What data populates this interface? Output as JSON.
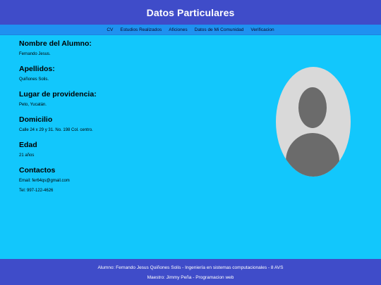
{
  "header": {
    "title": "Datos Particulares"
  },
  "nav": {
    "items": [
      "CV",
      "Estudios Realizados",
      "Aficiones",
      "Datos de Mi Comunidad",
      "Verificacion"
    ]
  },
  "profile": {
    "name_heading": "Nombre del Alumno:",
    "name_value": "Fernando Jesus.",
    "surname_heading": "Apellidos:",
    "surname_value": "Quiñones Solis.",
    "origin_heading": "Lugar de providencia:",
    "origin_value": "Peto, Yucatán.",
    "address_heading": "Domicilio",
    "address_value": "Calle 24 x 29 y 31. No. 198 Col. centro.",
    "age_heading": "Edad",
    "age_value": "21 años",
    "contacts_heading": "Contactos",
    "email": "Email: fer64qs@gmail.com",
    "phone": "Tel: 997-122-4626"
  },
  "footer": {
    "line1": "Alumno: Fernando Jesus Quiñones Solis - Ingeniería en sistemas computacionales - 8 AVS",
    "line2": "Maestro: Jimmy Peña - Programacion web"
  },
  "colors": {
    "page_background": "#12c7fc",
    "header_background": "#3f4cc9",
    "nav_background": "#1f91f0",
    "avatar_background": "#d9d9d9",
    "avatar_silhouette": "#6b6b6b"
  },
  "icons": {
    "avatar": "user-placeholder-icon"
  }
}
